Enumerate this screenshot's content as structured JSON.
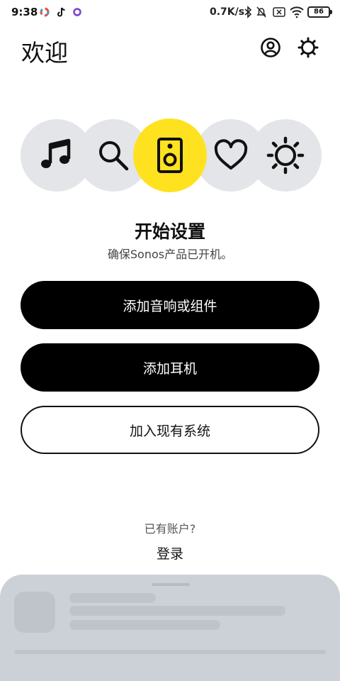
{
  "status_bar": {
    "time": "9:38",
    "net_speed": "0.7K/s",
    "battery": "86"
  },
  "header": {
    "title": "欢迎"
  },
  "hero": {
    "icons": [
      "music-note-icon",
      "search-icon",
      "speaker-icon",
      "heart-icon",
      "sun-icon"
    ],
    "active_color": "#ffe21f",
    "inactive_color": "#e3e5e8"
  },
  "setup": {
    "title": "开始设置",
    "subtitle": "确保Sonos产品已开机。"
  },
  "actions": {
    "add_speaker": "添加音响或组件",
    "add_headphones": "添加耳机",
    "join_system": "加入现有系统"
  },
  "account": {
    "prompt": "已有账户?",
    "login": "登录"
  }
}
